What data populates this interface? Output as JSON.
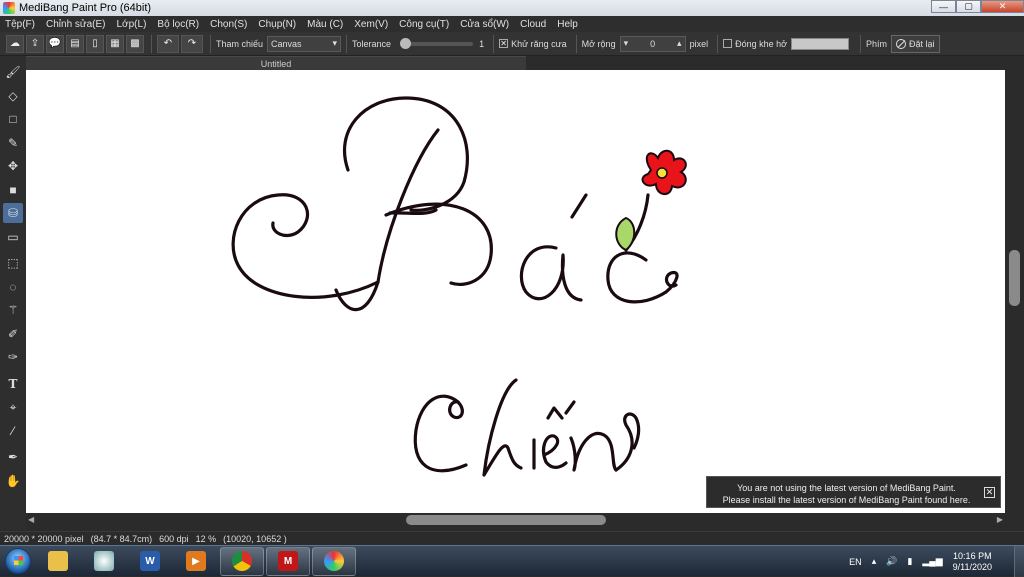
{
  "window": {
    "title": "MediBang Paint Pro (64bit)",
    "minimize": "—",
    "maximize": "▢",
    "close": "✕"
  },
  "menu": [
    "Tệp(F)",
    "Chỉnh sửa(E)",
    "Lớp(L)",
    "Bộ lọc(R)",
    "Chọn(S)",
    "Chụp(N)",
    "Màu (C)",
    "Xem(V)",
    "Công cụ(T)",
    "Cửa sổ(W)",
    "Cloud",
    "Help"
  ],
  "toolbar": {
    "reference_label": "Tham chiếu",
    "reference_value": "Canvas",
    "tolerance_label": "Tolerance",
    "tolerance_value": "1",
    "tolerance_level": 0.01,
    "antialias_label": "Khử răng cưa",
    "antialias_checked": "✕",
    "expand_label": "Mở rộng",
    "expand_value": "0",
    "expand_unit": "pixel",
    "close_gap_label": "Đóng khe hở",
    "key_label": "Phím",
    "reset_label": "Đặt lại"
  },
  "document": {
    "tab_title": "Untitled"
  },
  "notification": {
    "line1": "You are not using the latest version of MediBang Paint.",
    "line2": "Please install the latest version of MediBang Paint found here.",
    "close": "✕"
  },
  "status": {
    "size": "20000 * 20000 pixel",
    "physical": "(84.7 * 84.7cm)",
    "dpi": "600 dpi",
    "zoom": "12 %",
    "coords": "(10020, 10652 )"
  },
  "taskbar": {
    "language": "EN",
    "time": "10:16 PM",
    "date": "9/11/2020"
  },
  "icons": {
    "tools": [
      "brush-icon",
      "eraser-icon",
      "rectangle-icon",
      "dot-brush-icon",
      "move-icon",
      "fill-rect-icon",
      "bucket-icon",
      "gradient-icon",
      "select-rect-icon",
      "lasso-icon",
      "magic-wand-icon",
      "select-pen-icon",
      "select-eraser-icon",
      "text-icon",
      "operation-icon",
      "eyedropper-icon",
      "dropper-icon",
      "hand-icon"
    ]
  },
  "colors": {
    "canvas": "#ffffff",
    "ink": "#1a0a12",
    "flower": "#e8141a",
    "flower_center": "#f3e23a",
    "leaf": "#a8d86a",
    "ui_dark": "#2e2e2e"
  }
}
